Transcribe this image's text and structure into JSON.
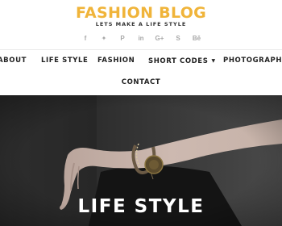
{
  "site": {
    "title": "FASHION BLOG",
    "tagline": "LETS MAKE A LIFE STYLE",
    "accent_color": "#f0b43a"
  },
  "social": [
    {
      "icon": "facebook-icon",
      "glyph": "f"
    },
    {
      "icon": "twitter-icon",
      "glyph": "✦"
    },
    {
      "icon": "pinterest-icon",
      "glyph": "P"
    },
    {
      "icon": "linkedin-icon",
      "glyph": "in"
    },
    {
      "icon": "google-plus-icon",
      "glyph": "G+"
    },
    {
      "icon": "skype-icon",
      "glyph": "S"
    },
    {
      "icon": "behance-icon",
      "glyph": "Bē"
    }
  ],
  "nav": {
    "about": "ABOUT",
    "life_style": "LIFE STYLE",
    "fashion": "FASHION",
    "short_codes": "SHORT CODES",
    "photography": "PHOTOGRAPHY",
    "contact": "CONTACT"
  },
  "hero": {
    "title": "LIFE STYLE"
  }
}
